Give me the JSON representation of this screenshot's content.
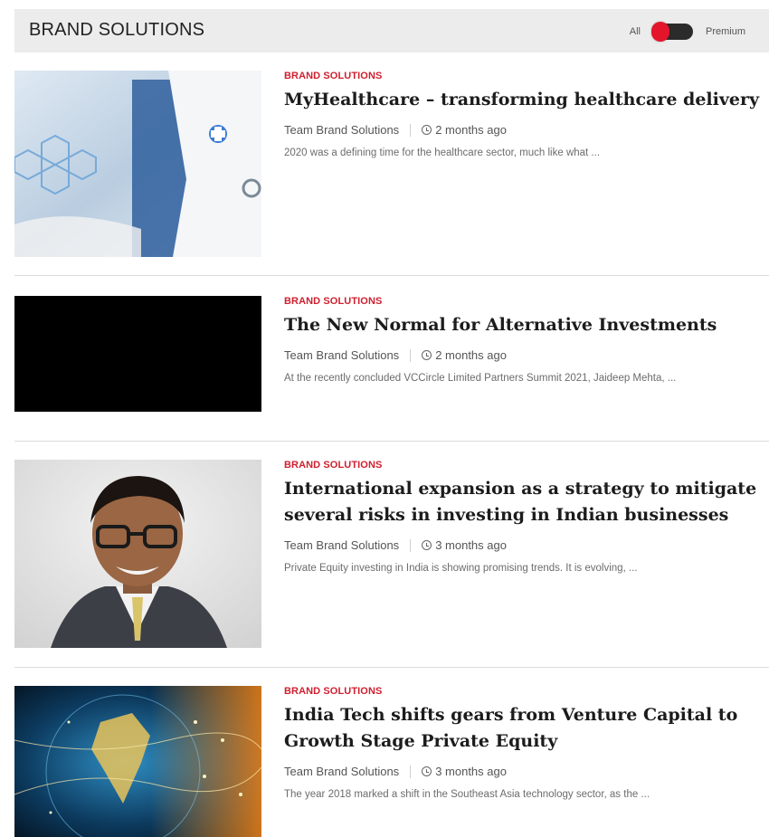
{
  "header": {
    "title": "BRAND SOLUTIONS",
    "toggle_left_label": "All",
    "toggle_right_label": "Premium"
  },
  "articles": [
    {
      "category": "BRAND SOLUTIONS",
      "title": "MyHealthcare – transforming healthcare delivery",
      "author": "Team Brand Solutions",
      "time": "2 months ago",
      "excerpt": "2020 was a defining time for the healthcare sector, much like what ..."
    },
    {
      "category": "BRAND SOLUTIONS",
      "title": "The New Normal for Alternative Investments",
      "author": "Team Brand Solutions",
      "time": "2 months ago",
      "excerpt": "At the recently concluded VCCircle Limited Partners Summit 2021, Jaideep Mehta, ..."
    },
    {
      "category": "BRAND SOLUTIONS",
      "title": "International expansion as a strategy to mitigate several risks in investing in Indian businesses",
      "author": "Team Brand Solutions",
      "time": "3 months ago",
      "excerpt": "Private Equity investing in India is showing promising trends. It is evolving, ..."
    },
    {
      "category": "BRAND SOLUTIONS",
      "title": "India Tech shifts gears from Venture Capital to Growth Stage Private Equity",
      "author": "Team Brand Solutions",
      "time": "3 months ago",
      "excerpt": "The year 2018 marked a shift in the Southeast Asia technology sector, as the ..."
    }
  ],
  "colors": {
    "accent_red": "#cf1f2e",
    "toggle_knob": "#e4142a",
    "header_bg": "#ececec"
  }
}
